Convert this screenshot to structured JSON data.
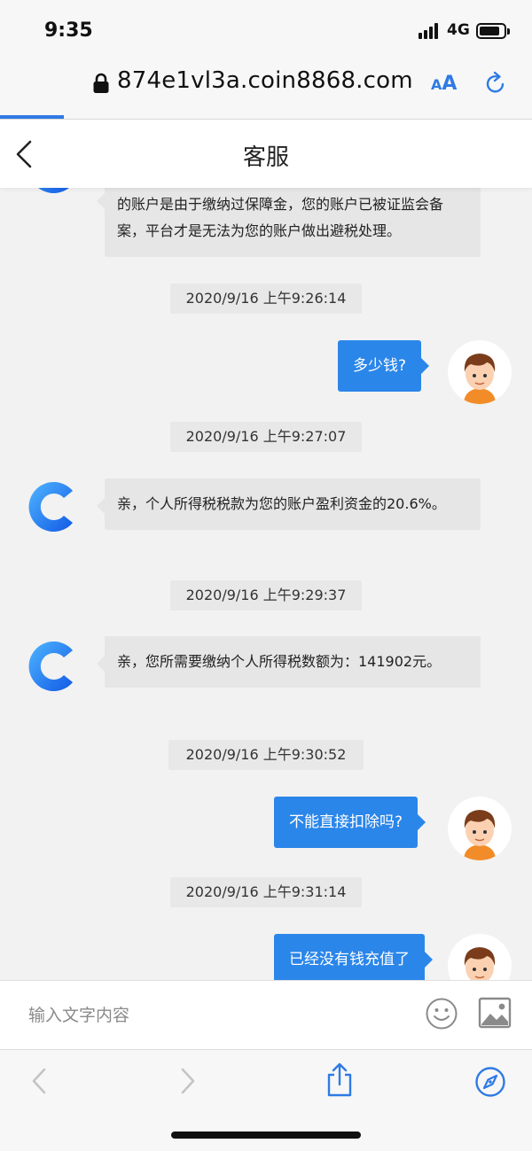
{
  "status": {
    "time": "9:35",
    "network": "4G",
    "battery_level": 0.85
  },
  "browser": {
    "url": "874e1vl3a.coin8868.com",
    "text_size_small": "A",
    "text_size_large": "A",
    "load_progress": 0.12
  },
  "header": {
    "title": "客服"
  },
  "messages": {
    "m0": {
      "text": "的账户是由于缴纳过保障金，您的账户已被证监会备案，平台才是无法为您的账户做出避税处理。"
    },
    "ts1": "2020/9/16 上午9:26:14",
    "m1": {
      "text": "多少钱?"
    },
    "ts2": "2020/9/16 上午9:27:07",
    "m2": {
      "text": "亲，个人所得税税款为您的账户盈利资金的20.6%。"
    },
    "ts3": "2020/9/16 上午9:29:37",
    "m3": {
      "text": "亲，您所需要缴纳个人所得税数额为：141902元。"
    },
    "ts4": "2020/9/16 上午9:30:52",
    "m4": {
      "text": "不能直接扣除吗?"
    },
    "ts5": "2020/9/16 上午9:31:14",
    "m5": {
      "text": "已经没有钱充值了"
    }
  },
  "composer": {
    "placeholder": "输入文字内容"
  },
  "colors": {
    "accent": "#2f7ae5",
    "user_bubble": "#2b86e9",
    "agent_bubble": "#e6e6e6"
  },
  "icons": {
    "lock": "lock-icon",
    "reload": "reload-icon",
    "back": "chevron-left-icon",
    "emoji": "smiley-icon",
    "image": "image-icon",
    "share": "share-icon",
    "compass": "compass-icon"
  }
}
